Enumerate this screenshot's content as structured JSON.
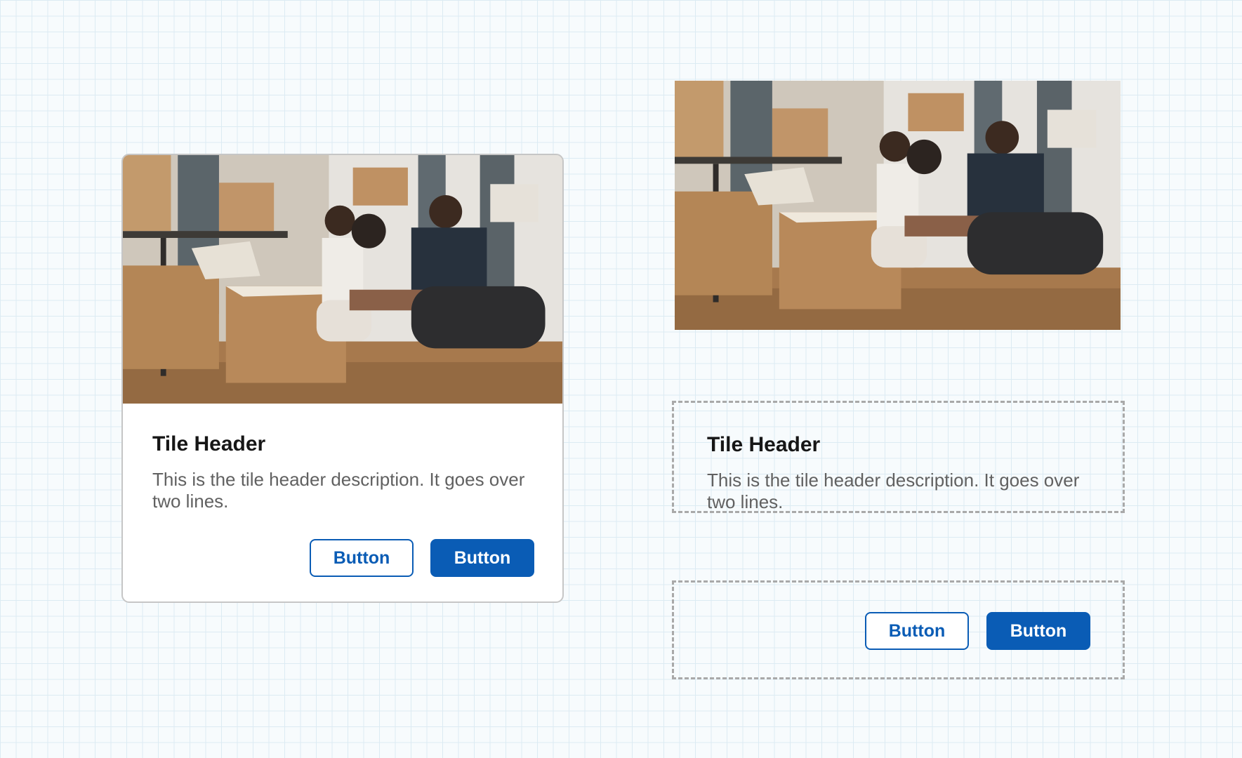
{
  "tile_card": {
    "header": "Tile Header",
    "description": "This is the tile header description. It goes over two lines.",
    "secondary_button": "Button",
    "primary_button": "Button"
  },
  "anatomy": {
    "header": "Tile Header",
    "description": "This is the tile header description. It goes over two lines.",
    "secondary_button": "Button",
    "primary_button": "Button"
  },
  "colors": {
    "accent": "#0a5cb5",
    "card_border": "#c6c6c6",
    "dashed_outline": "#a9a9a9",
    "grid_line": "#dcebf3"
  },
  "images": [
    "family-moving-boxes-photo",
    "family-moving-boxes-photo"
  ]
}
